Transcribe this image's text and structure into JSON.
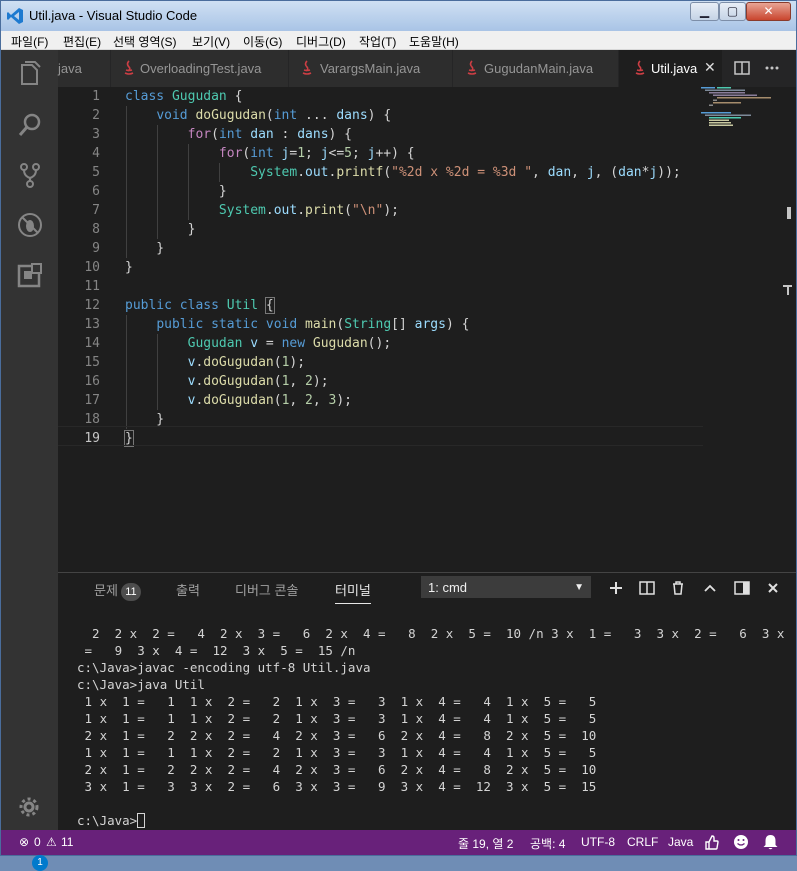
{
  "window": {
    "title": "Util.java - Visual Studio Code"
  },
  "menu": [
    "파일(F)",
    "편집(E)",
    "선택 영역(S)",
    "보기(V)",
    "이동(G)",
    "디버그(D)",
    "작업(T)",
    "도움말(H)"
  ],
  "tabs": [
    {
      "label": "java",
      "active": false
    },
    {
      "label": "OverloadingTest.java",
      "active": false
    },
    {
      "label": "VarargsMain.java",
      "active": false
    },
    {
      "label": "GugudanMain.java",
      "active": false
    },
    {
      "label": "Util.java",
      "active": true
    }
  ],
  "editor": {
    "line_numbers": [
      "1",
      "2",
      "3",
      "4",
      "5",
      "6",
      "7",
      "8",
      "9",
      "10",
      "11",
      "12",
      "13",
      "14",
      "15",
      "16",
      "17",
      "18",
      "19"
    ],
    "current_line": "19"
  },
  "activity": {
    "extensions_badge": "1"
  },
  "panel": {
    "tabs": {
      "problems": "문제",
      "problems_count": "11",
      "output": "출력",
      "debug_console": "디버그 콘솔",
      "terminal": "터미널"
    },
    "terminal_select": "1: cmd",
    "terminal_lines": [
      "  2  2 x  2 =   4  2 x  3 =   6  2 x  4 =   8  2 x  5 =  10 /n 3 x  1 =   3  3 x  2 =   6  3 x  3",
      " =   9  3 x  4 =  12  3 x  5 =  15 /n",
      "c:\\Java>javac -encoding utf-8 Util.java",
      "",
      "c:\\Java>java Util",
      " 1 x  1 =   1  1 x  2 =   2  1 x  3 =   3  1 x  4 =   4  1 x  5 =   5",
      " 1 x  1 =   1  1 x  2 =   2  1 x  3 =   3  1 x  4 =   4  1 x  5 =   5",
      " 2 x  1 =   2  2 x  2 =   4  2 x  3 =   6  2 x  4 =   8  2 x  5 =  10",
      " 1 x  1 =   1  1 x  2 =   2  1 x  3 =   3  1 x  4 =   4  1 x  5 =   5",
      " 2 x  1 =   2  2 x  2 =   4  2 x  3 =   6  2 x  4 =   8  2 x  5 =  10",
      " 3 x  1 =   3  3 x  2 =   6  3 x  3 =   9  3 x  4 =  12  3 x  5 =  15",
      "",
      "c:\\Java>"
    ]
  },
  "status": {
    "errors": "0",
    "warnings": "11",
    "position": "줄 19, 열 2",
    "indent": "공백: 4",
    "encoding": "UTF-8",
    "eol": "CRLF",
    "language": "Java"
  },
  "colors": {
    "statusbar": "#68217a",
    "accent": "#007acc",
    "editor_bg": "#1e1e1e"
  }
}
